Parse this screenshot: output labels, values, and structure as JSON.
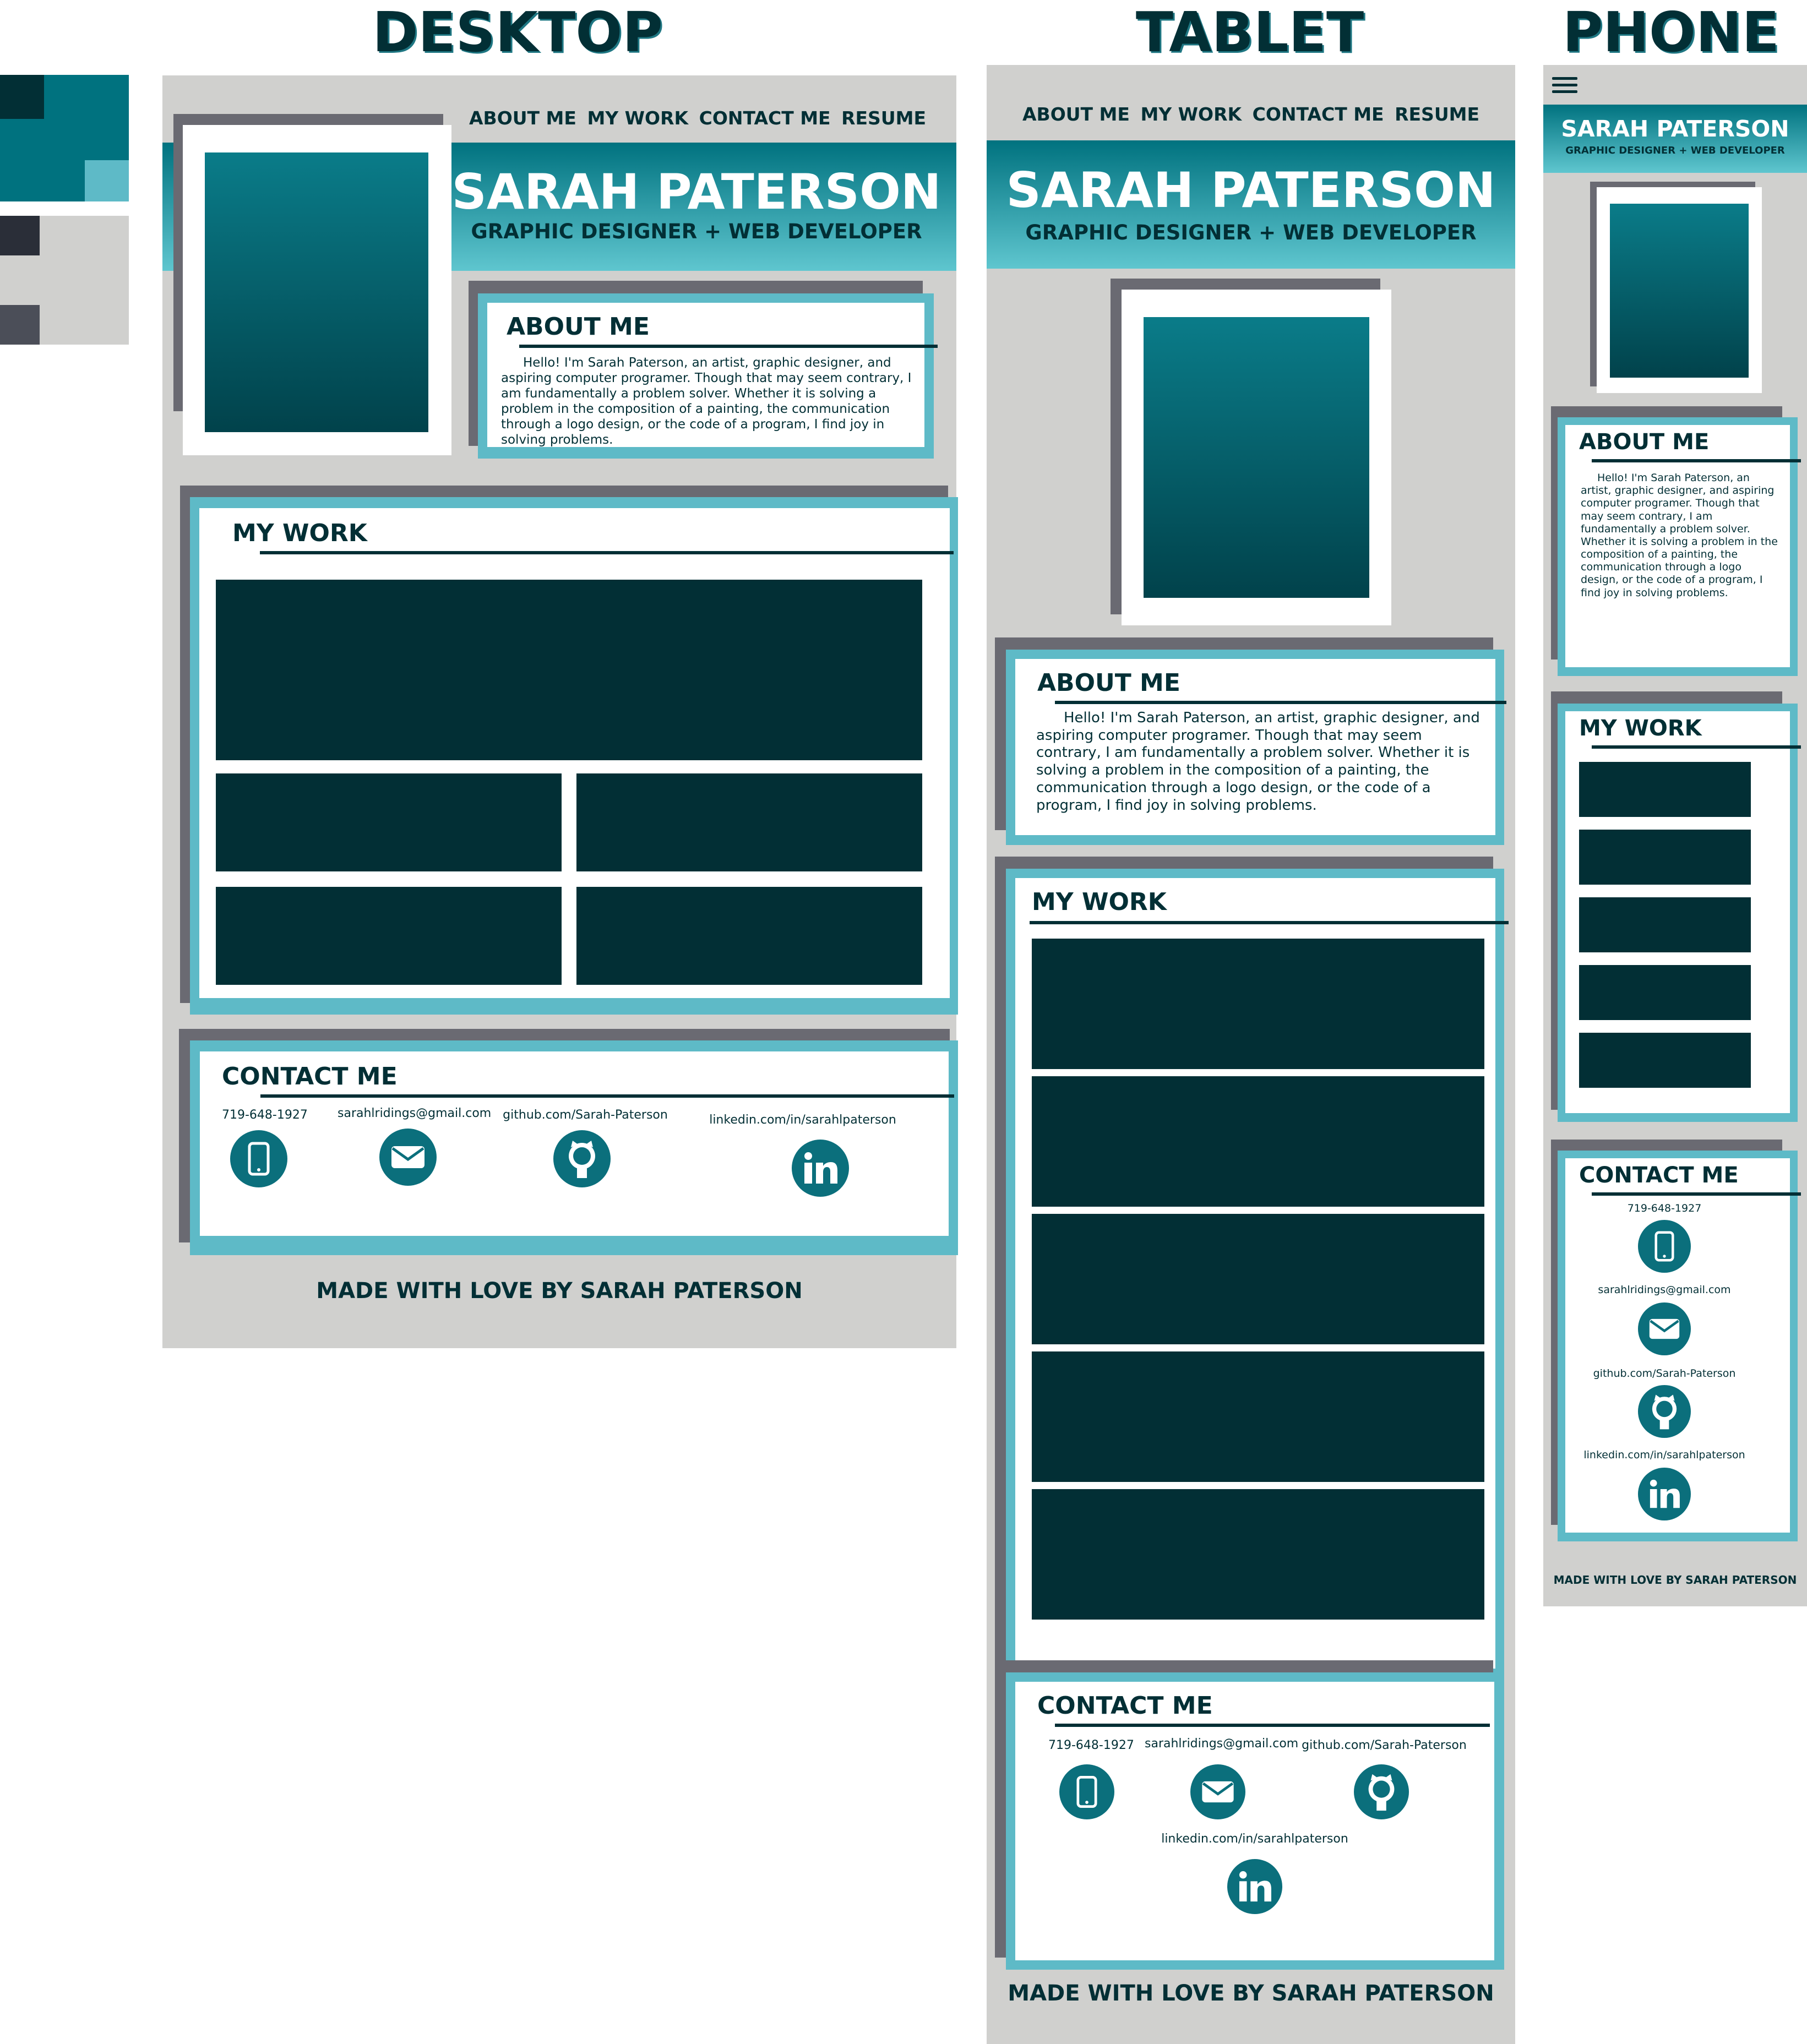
{
  "titles": {
    "desktop": "DESKTOP",
    "tablet": "TABLET",
    "phone": "PHONE"
  },
  "nav": {
    "about": "ABOUT ME",
    "work": "MY WORK",
    "contact": "CONTACT ME",
    "resume": "RESUME"
  },
  "header": {
    "name": "SARAH PATERSON",
    "subtitle": "GRAPHIC DESIGNER + WEB DEVELOPER"
  },
  "about": {
    "heading": "ABOUT ME",
    "text": "Hello! I'm Sarah Paterson, an artist, graphic designer, and aspiring computer programer. Though that may seem contrary, I am fundamentally a problem solver. Whether it is solving a problem in the composition of a painting, the communication through a logo design, or the code of a program, I find joy in solving problems."
  },
  "work": {
    "heading": "MY WORK"
  },
  "contact": {
    "heading": "CONTACT ME",
    "phone": "719-648-1927",
    "email": "sarahlridings@gmail.com",
    "github": "github.com/Sarah-Paterson",
    "linkedin": "linkedin.com/in/sarahlpaterson"
  },
  "footer": {
    "text": "MADE WITH LOVE BY SARAH PATERSON"
  },
  "icons": {
    "phone": "phone-icon",
    "email": "email-icon",
    "github": "github-icon",
    "linkedin": "linkedin-icon",
    "menu": "hamburger-menu-icon"
  },
  "palette": {
    "dark_teal": "#022f35",
    "teal": "#00727f",
    "light_teal": "#5ebac7",
    "light_gray": "#d0d0ce",
    "charcoal": "#2a2e38",
    "slate": "#4b4e58"
  }
}
